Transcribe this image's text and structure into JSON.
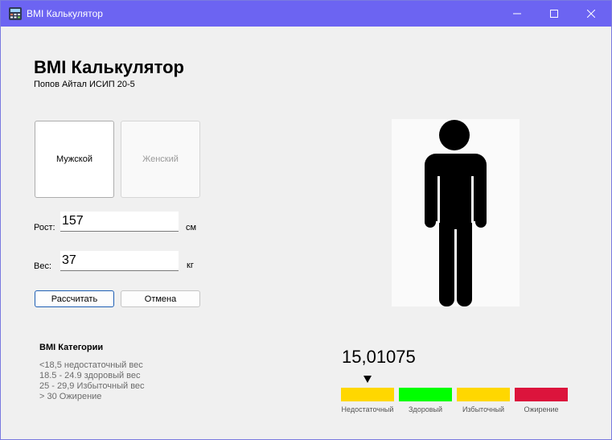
{
  "window": {
    "title": "BMI Калькулятор"
  },
  "header": {
    "title": "BMI Калькулятор",
    "subtitle": "Попов Айтал ИСИП 20-5"
  },
  "gender": {
    "male_label": "Мужской",
    "female_label": "Женский",
    "selected": "male"
  },
  "form": {
    "height_label": "Рост:",
    "height_value": "157",
    "height_unit": "см",
    "weight_label": "Вес:",
    "weight_value": "37",
    "weight_unit": "кг"
  },
  "buttons": {
    "calculate": "Рассчитать",
    "cancel": "Отмена"
  },
  "categories": {
    "title": "BMI Категории",
    "lines": [
      "<18,5 недостаточный вес",
      "18.5 - 24.9 здоровый вес",
      "25 - 29,9 Избыточный вес",
      "> 30 Ожирение"
    ]
  },
  "result": {
    "bmi": "15,01075",
    "active_category": "Недостаточный",
    "scale": [
      {
        "label": "Недостаточный",
        "color": "#ffd700"
      },
      {
        "label": "Здоровый",
        "color": "#00ff00"
      },
      {
        "label": "Избыточный",
        "color": "#ffd700"
      },
      {
        "label": "Ожирение",
        "color": "#dc143c"
      }
    ]
  },
  "colors": {
    "titlebar": "#6c64f2",
    "accent": "#1e5fb4"
  }
}
